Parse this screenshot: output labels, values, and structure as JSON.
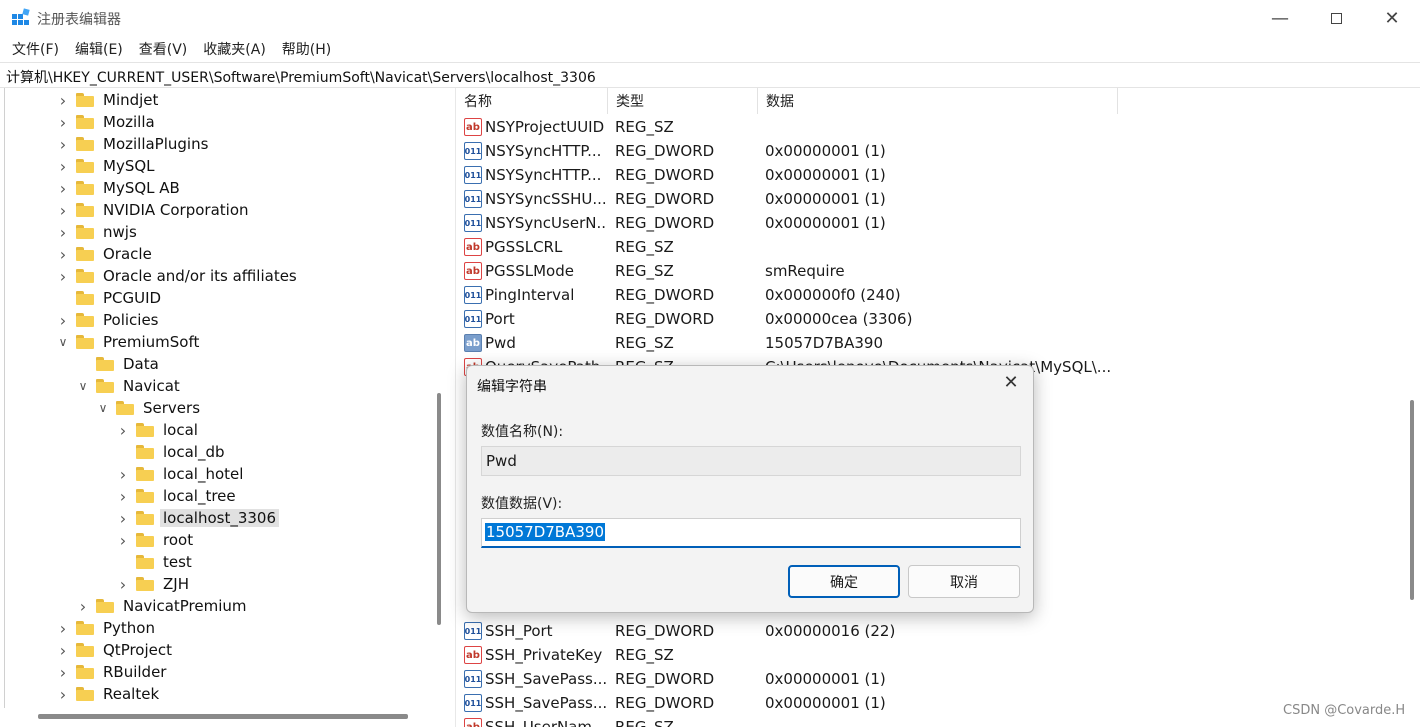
{
  "window": {
    "title": "注册表编辑器",
    "accent": "#0078d7"
  },
  "menu": [
    "文件(F)",
    "编辑(E)",
    "查看(V)",
    "收藏夹(A)",
    "帮助(H)"
  ],
  "address": "计算机\\HKEY_CURRENT_USER\\Software\\PremiumSoft\\Navicat\\Servers\\localhost_3306",
  "tree": [
    {
      "label": "Mindjet",
      "expander": "collapsed"
    },
    {
      "label": "Mozilla",
      "expander": "collapsed"
    },
    {
      "label": "MozillaPlugins",
      "expander": "collapsed"
    },
    {
      "label": "MySQL",
      "expander": "collapsed"
    },
    {
      "label": "MySQL AB",
      "expander": "collapsed"
    },
    {
      "label": "NVIDIA Corporation",
      "expander": "collapsed"
    },
    {
      "label": "nwjs",
      "expander": "collapsed"
    },
    {
      "label": "Oracle",
      "expander": "collapsed"
    },
    {
      "label": "Oracle and/or its affiliates",
      "expander": "collapsed"
    },
    {
      "label": "PCGUID",
      "expander": "none"
    },
    {
      "label": "Policies",
      "expander": "collapsed"
    },
    {
      "label": "PremiumSoft",
      "expander": "expanded"
    },
    {
      "label": "Data",
      "expander": "none"
    },
    {
      "label": "Navicat",
      "expander": "expanded"
    },
    {
      "label": "Servers",
      "expander": "expanded"
    },
    {
      "label": "local",
      "expander": "collapsed"
    },
    {
      "label": "local_db",
      "expander": "none"
    },
    {
      "label": "local_hotel",
      "expander": "collapsed"
    },
    {
      "label": "local_tree",
      "expander": "collapsed"
    },
    {
      "label": "localhost_3306",
      "expander": "collapsed",
      "selected": true
    },
    {
      "label": "root",
      "expander": "collapsed"
    },
    {
      "label": "test",
      "expander": "none"
    },
    {
      "label": "ZJH",
      "expander": "collapsed"
    },
    {
      "label": "NavicatPremium",
      "expander": "collapsed"
    },
    {
      "label": "Python",
      "expander": "collapsed"
    },
    {
      "label": "QtProject",
      "expander": "collapsed"
    },
    {
      "label": "RBuilder",
      "expander": "collapsed"
    },
    {
      "label": "Realtek",
      "expander": "collapsed"
    }
  ],
  "columns": {
    "name": "名称",
    "type": "类型",
    "data": "数据"
  },
  "values": [
    {
      "icon": "ab",
      "name": "NSYProjectUUID",
      "type": "REG_SZ",
      "data": ""
    },
    {
      "icon": "dw",
      "name": "NSYSyncHTTP...",
      "type": "REG_DWORD",
      "data": "0x00000001 (1)"
    },
    {
      "icon": "dw",
      "name": "NSYSyncHTTP...",
      "type": "REG_DWORD",
      "data": "0x00000001 (1)"
    },
    {
      "icon": "dw",
      "name": "NSYSyncSSHU...",
      "type": "REG_DWORD",
      "data": "0x00000001 (1)"
    },
    {
      "icon": "dw",
      "name": "NSYSyncUserN...",
      "type": "REG_DWORD",
      "data": "0x00000001 (1)"
    },
    {
      "icon": "ab",
      "name": "PGSSLCRL",
      "type": "REG_SZ",
      "data": ""
    },
    {
      "icon": "ab",
      "name": "PGSSLMode",
      "type": "REG_SZ",
      "data": "smRequire"
    },
    {
      "icon": "dw",
      "name": "PingInterval",
      "type": "REG_DWORD",
      "data": "0x000000f0 (240)"
    },
    {
      "icon": "dw",
      "name": "Port",
      "type": "REG_DWORD",
      "data": "0x00000cea (3306)"
    },
    {
      "icon": "ab-sel",
      "name": "Pwd",
      "type": "REG_SZ",
      "data": "15057D7BA390"
    },
    {
      "icon": "ab",
      "name": "QuerySavePath",
      "type": "REG_SZ",
      "data": "C:\\Users\\lenovo\\Documents\\Navicat\\MySQL\\..."
    }
  ],
  "values_bottom": [
    {
      "icon": "dw",
      "name": "SSH_Port",
      "type": "REG_DWORD",
      "data": "0x00000016 (22)"
    },
    {
      "icon": "ab",
      "name": "SSH_PrivateKey",
      "type": "REG_SZ",
      "data": ""
    },
    {
      "icon": "dw",
      "name": "SSH_SavePass...",
      "type": "REG_DWORD",
      "data": "0x00000001 (1)"
    },
    {
      "icon": "dw",
      "name": "SSH_SavePass...",
      "type": "REG_DWORD",
      "data": "0x00000001 (1)"
    },
    {
      "icon": "ab",
      "name": "SSH_UserNam...",
      "type": "REG_SZ",
      "data": ""
    }
  ],
  "dialog": {
    "title": "编辑字符串",
    "name_label": "数值名称(N):",
    "name_value": "Pwd",
    "data_label": "数值数据(V):",
    "data_value": "15057D7BA390",
    "ok": "确定",
    "cancel": "取消"
  },
  "watermark": "CSDN @Covarde.H"
}
